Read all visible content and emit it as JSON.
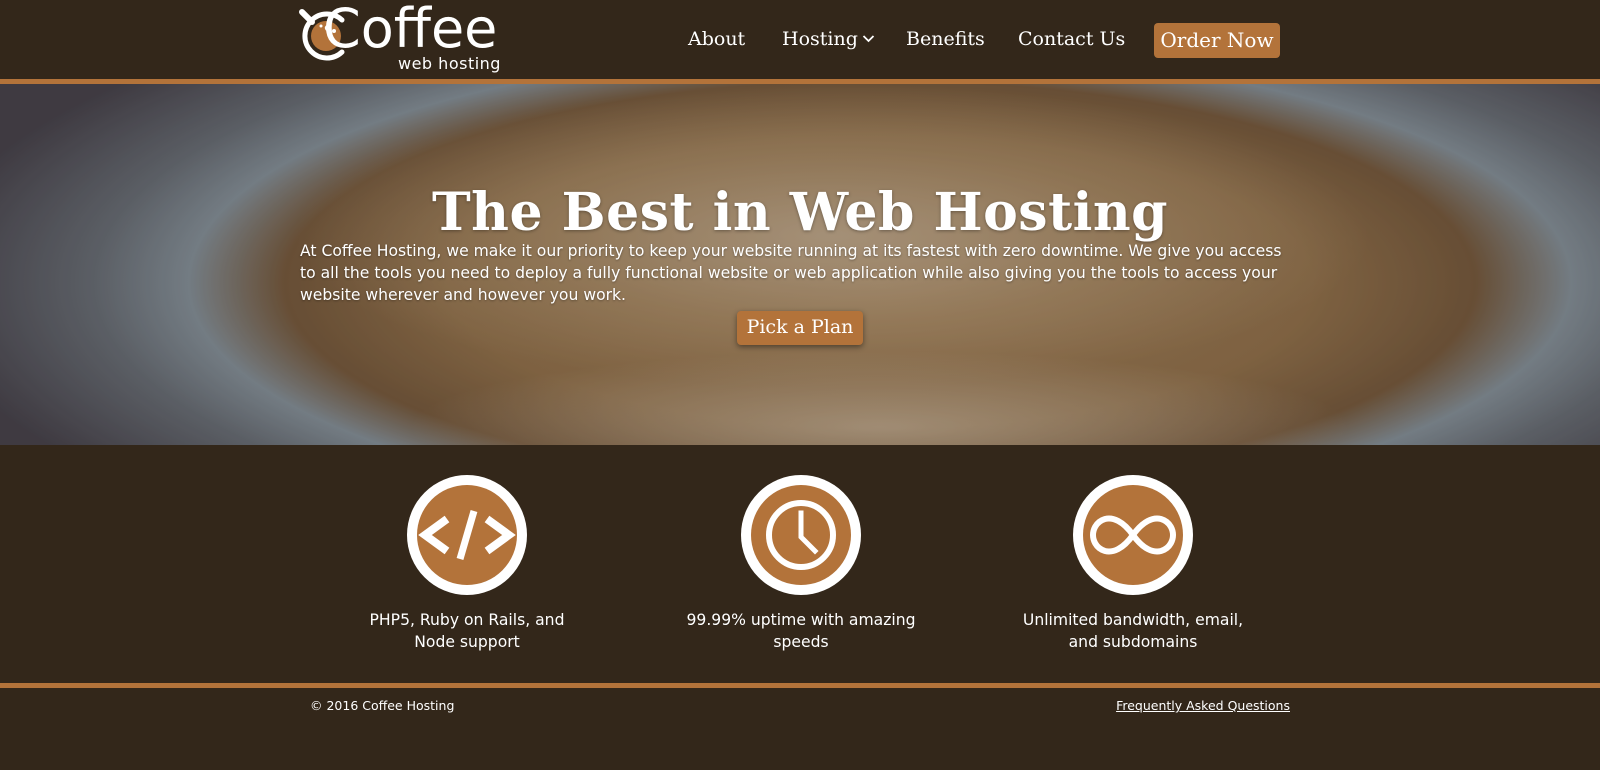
{
  "brand": {
    "name": "Coffee",
    "tagline": "web hosting",
    "accent_color": "#b3733a",
    "background_color": "#33271a"
  },
  "nav": {
    "items": [
      {
        "label": "About"
      },
      {
        "label": "Hosting",
        "has_dropdown": true,
        "icon": "chevron-down-icon"
      },
      {
        "label": "Benefits"
      },
      {
        "label": "Contact Us"
      }
    ],
    "cta_label": "Order Now"
  },
  "hero": {
    "title": "The Best in Web Hosting",
    "body": "At Coffee Hosting, we make it our priority to keep your website running at its fastest with zero downtime. We give you access to all the tools you need to deploy a fully functional website or web application while also giving you the tools to access your website wherever and however you work.",
    "cta_label": "Pick a Plan"
  },
  "features": [
    {
      "icon": "code-icon",
      "text": "PHP5, Ruby on Rails, and Node support"
    },
    {
      "icon": "clock-icon",
      "text": "99.99% uptime with amazing speeds"
    },
    {
      "icon": "infinity-icon",
      "text": "Unlimited bandwidth, email, and subdomains"
    }
  ],
  "footer": {
    "copyright": "© 2016 Coffee Hosting",
    "faq_link": "Frequently Asked Questions"
  }
}
